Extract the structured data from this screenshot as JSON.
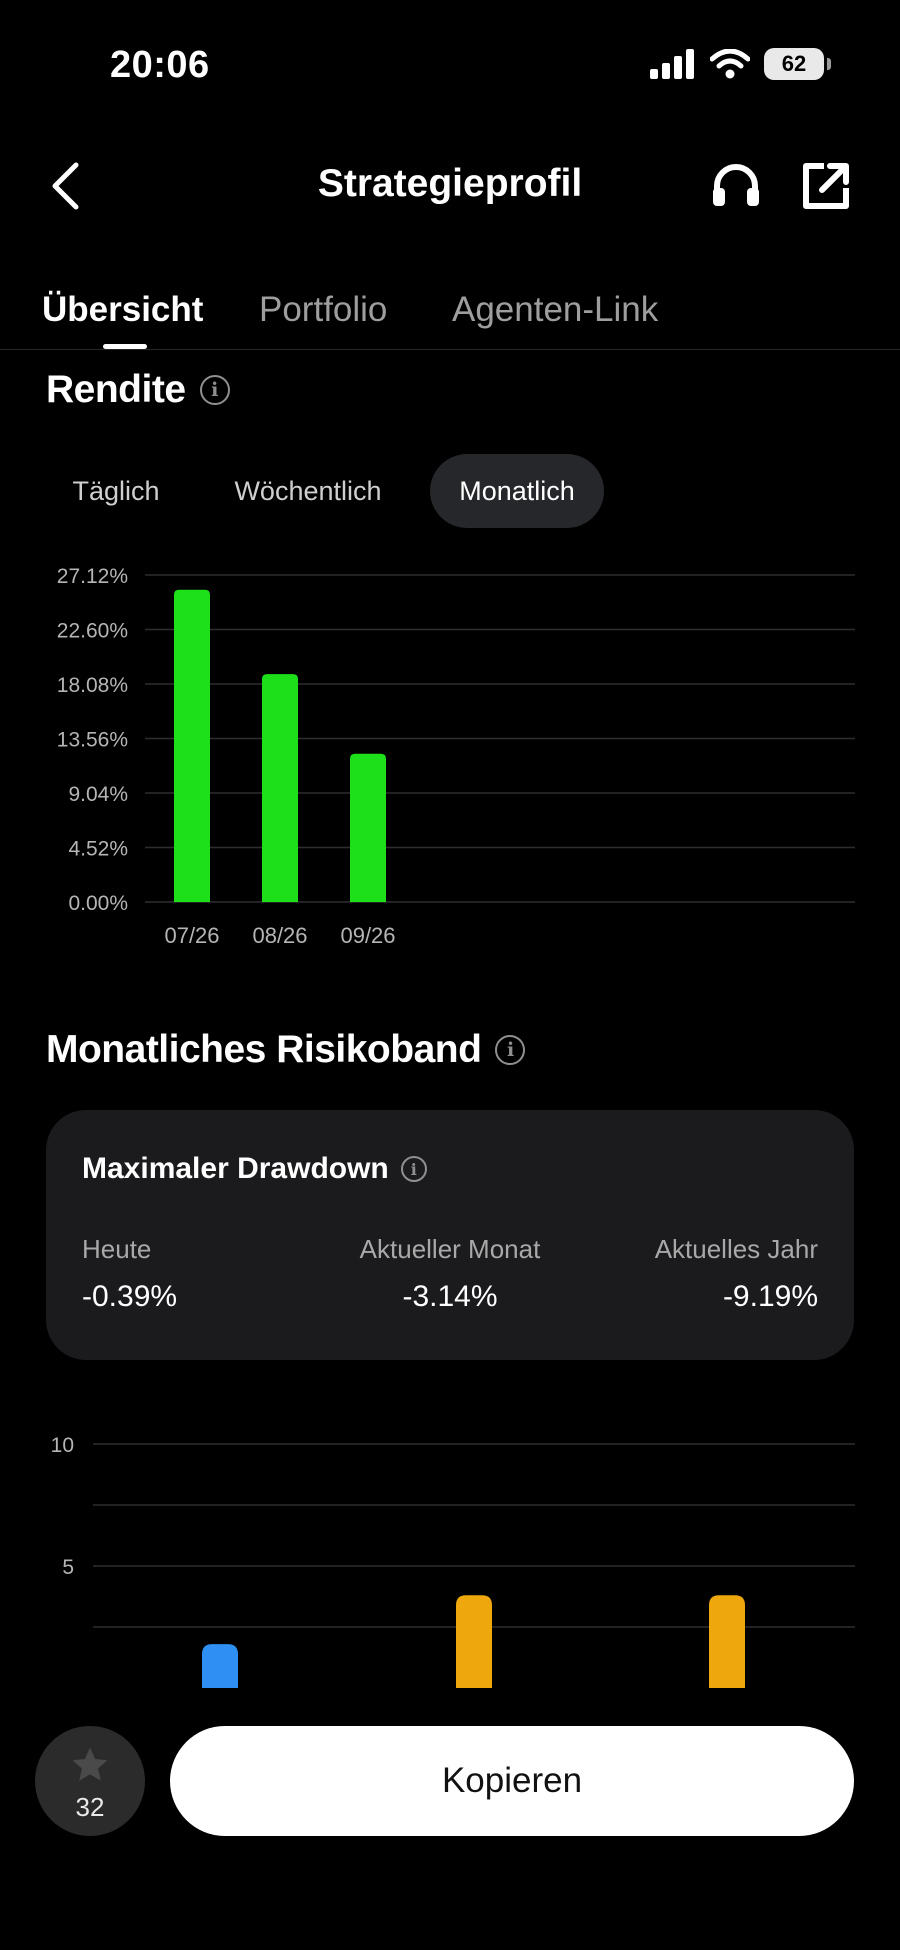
{
  "status_bar": {
    "time": "20:06",
    "battery": "62",
    "icons": [
      "signal-icon",
      "wifi-icon",
      "battery-icon"
    ]
  },
  "nav": {
    "title": "Strategieprofil",
    "icons": [
      "back-icon",
      "headset-icon",
      "share-icon"
    ]
  },
  "tabs": [
    {
      "label": "Übersicht",
      "active": true
    },
    {
      "label": "Portfolio",
      "active": false
    },
    {
      "label": "Agenten-Link",
      "active": false
    }
  ],
  "returns": {
    "title": "Rendite",
    "periods": [
      "Täglich",
      "Wöchentlich",
      "Monatlich"
    ],
    "selected_period": "Monatlich"
  },
  "risk": {
    "title": "Monatliches Risikoband",
    "card": {
      "title": "Maximaler Drawdown",
      "columns": [
        {
          "label": "Heute",
          "value": "-0.39%"
        },
        {
          "label": "Aktueller Monat",
          "value": "-3.14%"
        },
        {
          "label": "Aktuelles Jahr",
          "value": "-9.19%"
        }
      ]
    }
  },
  "chart_data": [
    {
      "type": "bar",
      "categories": [
        "07/26",
        "08/26",
        "09/26"
      ],
      "values": [
        25.9,
        18.9,
        12.3
      ],
      "yticks": [
        "0.00%",
        "4.52%",
        "9.04%",
        "13.56%",
        "18.08%",
        "22.60%",
        "27.12%"
      ],
      "ylim": [
        0,
        27.12
      ],
      "grid": true,
      "colors": {
        "bar": "#1ee01a",
        "grid": "#2e2e2e",
        "tick": "#b5b5b5"
      }
    },
    {
      "type": "bar",
      "values": [
        1.8,
        3.8,
        3.8
      ],
      "yticks": [
        "5",
        "10"
      ],
      "ylim": [
        0,
        10
      ],
      "grid": true,
      "colors": {
        "bars": [
          "#2f8ff3",
          "#eea80d",
          "#eea80d"
        ],
        "grid": "#2e2e2e",
        "tick": "#b5b5b5"
      }
    }
  ],
  "bottom_bar": {
    "favorite_count": "32",
    "copy_label": "Kopieren"
  }
}
